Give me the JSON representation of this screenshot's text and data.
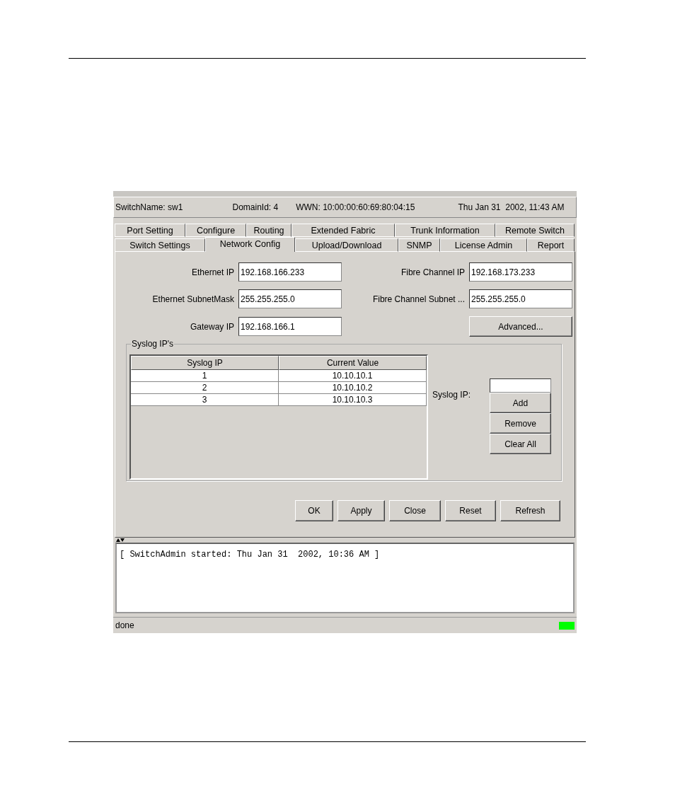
{
  "header": {
    "switch_name": "SwitchName: sw1",
    "domain_id": "DomainId: 4",
    "wwn": "WWN: 10:00:00:60:69:80:04:15",
    "datetime": "Thu Jan 31  2002, 11:43 AM"
  },
  "tab_rows": [
    [
      {
        "label": "Port Setting",
        "selected": false
      },
      {
        "label": "Configure",
        "selected": false
      },
      {
        "label": "Routing",
        "selected": false
      },
      {
        "label": "Extended Fabric",
        "selected": false
      },
      {
        "label": "Trunk Information",
        "selected": false
      },
      {
        "label": "Remote Switch",
        "selected": false
      }
    ],
    [
      {
        "label": "Switch Settings",
        "selected": false
      },
      {
        "label": "Network Config",
        "selected": true
      },
      {
        "label": "Upload/Download",
        "selected": false
      },
      {
        "label": "SNMP",
        "selected": false
      },
      {
        "label": "License Admin",
        "selected": false
      },
      {
        "label": "Report",
        "selected": false
      }
    ]
  ],
  "left_fields": [
    {
      "label": "Ethernet IP",
      "value": "192.168.166.233"
    },
    {
      "label": "Ethernet SubnetMask",
      "value": "255.255.255.0"
    },
    {
      "label": "Gateway IP",
      "value": "192.168.166.1"
    }
  ],
  "right_fields": [
    {
      "label": "Fibre Channel IP",
      "value": "192.168.173.233"
    },
    {
      "label": "Fibre Channel Subnet ...",
      "value": "255.255.255.0"
    }
  ],
  "advanced_button": "Advanced...",
  "syslog": {
    "title": "Syslog IP's",
    "columns": [
      "Syslog IP",
      "Current Value"
    ],
    "rows": [
      [
        "1",
        "10.10.10.1"
      ],
      [
        "2",
        "10.10.10.2"
      ],
      [
        "3",
        "10.10.10.3"
      ]
    ],
    "field_label": "Syslog IP:",
    "buttons": [
      "Add",
      "Remove",
      "Clear All"
    ]
  },
  "buttons": [
    "OK",
    "Apply",
    "Close",
    "Reset",
    "Refresh"
  ],
  "log": {
    "lines": [
      "[ SwitchAdmin started: Thu Jan 31  2002, 10:36 AM ]"
    ]
  },
  "status_bar": {
    "text": "done"
  }
}
